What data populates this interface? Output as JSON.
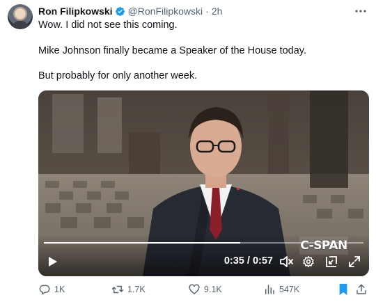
{
  "tweet": {
    "author_name": "Ron Filipkowski",
    "handle": "@RonFilipkowski",
    "separator": "·",
    "time": "2h",
    "lines": [
      "Wow. I did not see this coming.",
      "Mike Johnson finally became a Speaker of the House today.",
      "But probably for only another week."
    ]
  },
  "video": {
    "current_time": "0:35",
    "duration": "0:57",
    "time_separator": " / ",
    "progress_fraction": 0.614,
    "watermark": "C-SPAN",
    "icons": [
      "play-icon",
      "volume-muted-icon",
      "settings-icon",
      "picture-in-picture-icon",
      "fullscreen-icon"
    ]
  },
  "actions": {
    "replies": "1K",
    "reposts": "1.7K",
    "likes": "9.1K",
    "views": "547K"
  },
  "colors": {
    "text_primary": "#0f1419",
    "text_secondary": "#536471",
    "verified_blue": "#1d9bf0",
    "bookmark_active": "#1d9bf0"
  }
}
